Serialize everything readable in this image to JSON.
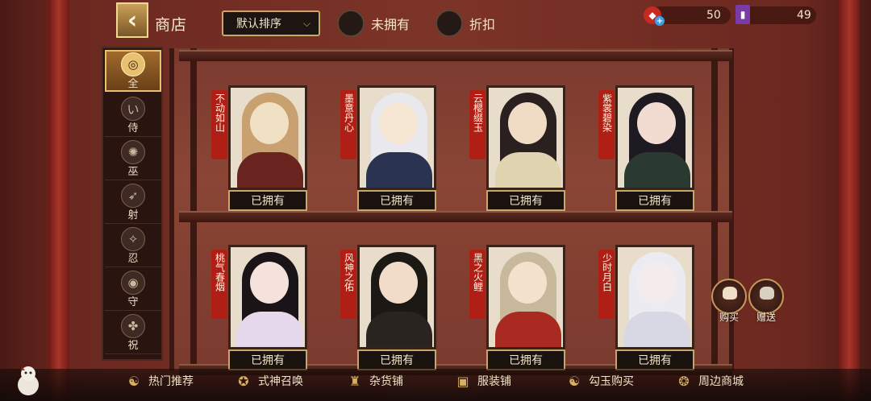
{
  "header": {
    "title": "商店",
    "sort_label": "默认排序",
    "filters": [
      {
        "label": "未拥有"
      },
      {
        "label": "折扣"
      }
    ],
    "currency": [
      {
        "icon": "red-jade-icon",
        "value": "50"
      },
      {
        "icon": "card-ticket-icon",
        "value": "49"
      }
    ]
  },
  "sidebar": {
    "items": [
      {
        "label": "全",
        "icon": "all-icon",
        "active": true
      },
      {
        "label": "侍",
        "icon": "samurai-icon"
      },
      {
        "label": "巫",
        "icon": "shaman-icon"
      },
      {
        "label": "射",
        "icon": "archer-icon"
      },
      {
        "label": "忍",
        "icon": "ninja-icon"
      },
      {
        "label": "守",
        "icon": "guardian-icon"
      },
      {
        "label": "祝",
        "icon": "blessing-icon"
      }
    ]
  },
  "skins": [
    {
      "name": "不动如山",
      "status": "已拥有"
    },
    {
      "name": "墨意丹心",
      "status": "已拥有"
    },
    {
      "name": "云樱缀玉",
      "status": "已拥有"
    },
    {
      "name": "紫裳碧染",
      "status": "已拥有"
    },
    {
      "name": "桃气春烟",
      "status": "已拥有"
    },
    {
      "name": "风神之佑",
      "status": "已拥有"
    },
    {
      "name": "黑之火鲤",
      "status": "已拥有"
    },
    {
      "name": "少时月白",
      "status": "已拥有"
    }
  ],
  "side_actions": [
    {
      "label": "购买",
      "icon": "cat-bag-icon"
    },
    {
      "label": "赠送",
      "icon": "gift-icon"
    }
  ],
  "bottom_nav": [
    {
      "label": "热门推荐",
      "icon": "hot-icon"
    },
    {
      "label": "式神召唤",
      "icon": "summon-icon"
    },
    {
      "label": "杂货铺",
      "icon": "store-icon"
    },
    {
      "label": "服装铺",
      "icon": "clothing-icon"
    },
    {
      "label": "勾玉购买",
      "icon": "magatama-icon"
    },
    {
      "label": "周边商城",
      "icon": "merch-icon"
    }
  ]
}
